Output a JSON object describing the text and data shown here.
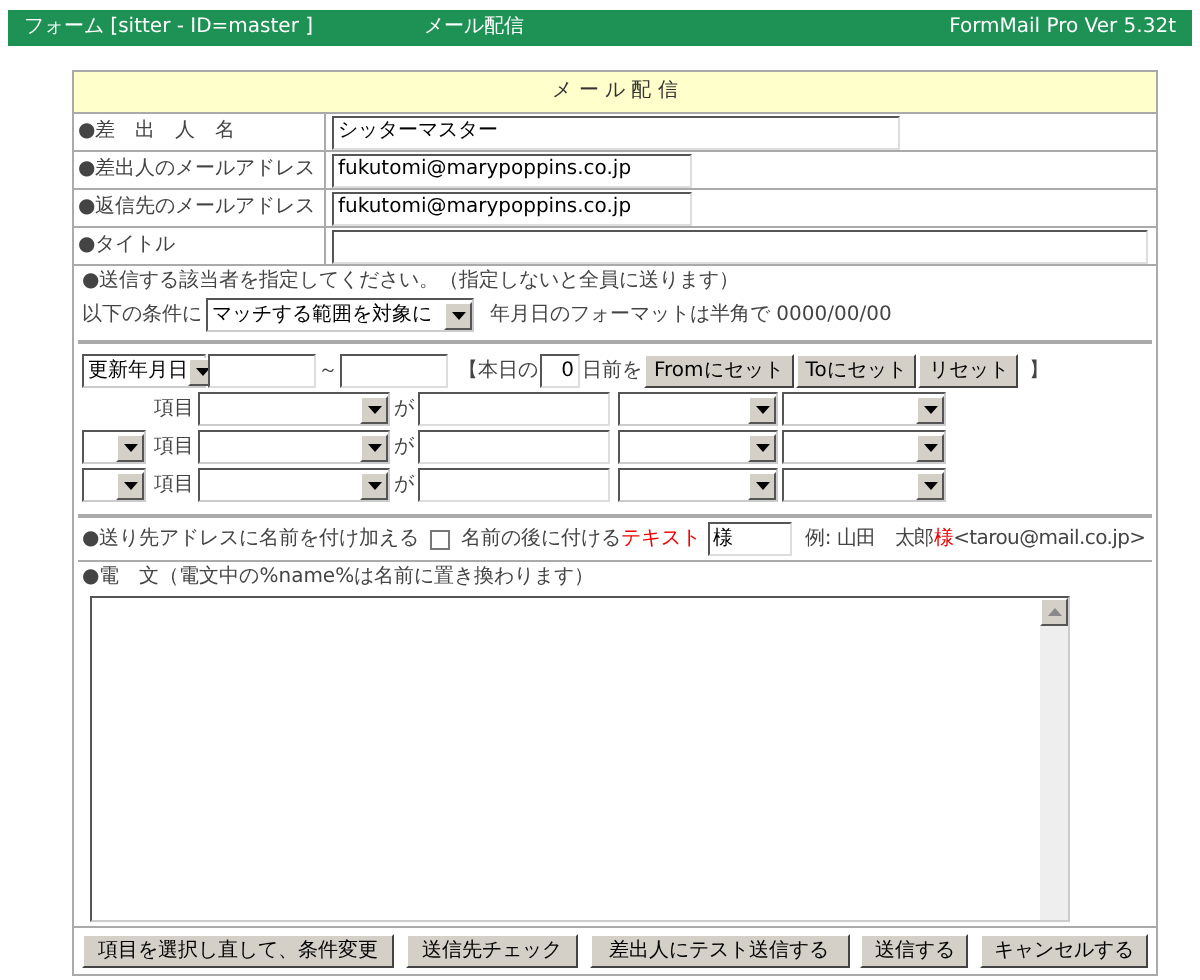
{
  "header": {
    "form_label": "フォーム [sitter - ID=master ]",
    "page_title": "メール配信",
    "version": "FormMail Pro Ver 5.32t"
  },
  "form": {
    "title": "メ ー ル 配 信",
    "fields": [
      {
        "label": "●差　出　人　名",
        "value": "シッターマスター"
      },
      {
        "label": "●差出人のメールアドレス",
        "value": "fukutomi@marypoppins.co.jp"
      },
      {
        "label": "●返信先のメールアドレス",
        "value": "fukutomi@marypoppins.co.jp"
      },
      {
        "label": "●タイトル"
      }
    ]
  },
  "condition": {
    "instruction": "●送信する該当者を指定してください。（指定しないと全員に送ります）",
    "prefix": "以下の条件に",
    "match_select": "マッチする範囲を対象に",
    "format_note": "年月日のフォーマットは半角で 0000/00/00"
  },
  "date_row": {
    "field_select": "更新年月日",
    "tilde": "～",
    "bracket_open": "【本日の",
    "days": "0",
    "days_suffix": "日前を",
    "buttons": [
      "Fromにセット",
      "Toにセット",
      "リセット"
    ],
    "bracket_close": "】"
  },
  "filter_rows": [
    {
      "kind": "first",
      "item_label": "項目",
      "particle": "が"
    },
    {
      "kind": "joined",
      "item_label": "項目",
      "particle": "が"
    },
    {
      "kind": "joined",
      "item_label": "項目",
      "particle": "が"
    }
  ],
  "name_option": {
    "label": "●送り先アドレスに名前を付け加える",
    "checked": false,
    "suffix_label": "名前の後に付ける",
    "suffix_highlight": "テキスト",
    "suffix_value": "様",
    "example_prefix": "例: 山田　太郎",
    "example_honorific": "様",
    "example_address": "<tarou@mail.co.jp>"
  },
  "body": {
    "label": "●電　文（電文中の%name%は名前に置き換わります）"
  },
  "buttons": [
    "項目を選択し直して、条件変更",
    "送信先チェック",
    "差出人にテスト送信する",
    "送信する",
    "キャンセルする"
  ]
}
